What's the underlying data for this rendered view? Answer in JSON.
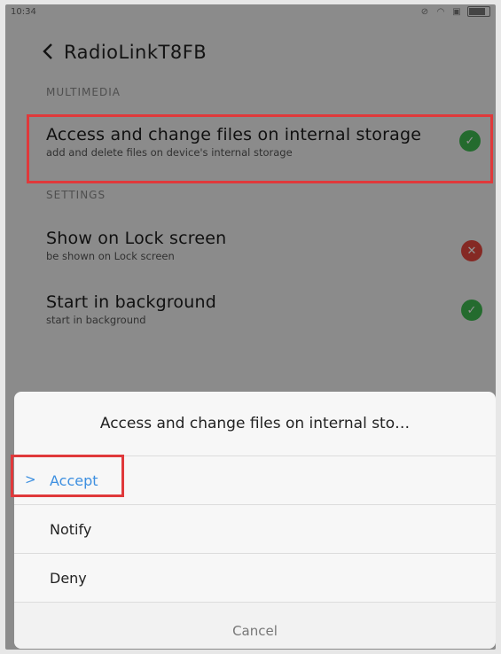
{
  "status_bar": {
    "time": "10:34"
  },
  "header": {
    "title": "RadioLinkT8FB"
  },
  "sections": {
    "multimedia": "MULTIMEDIA",
    "settings": "SETTINGS"
  },
  "permissions": [
    {
      "title": "Access and change files on internal storage",
      "subtitle": "add and delete files on device's internal storage",
      "status": "allowed"
    },
    {
      "title": "Show on Lock screen",
      "subtitle": "be shown on Lock screen",
      "status": "denied"
    },
    {
      "title": "Start in background",
      "subtitle": "start in background",
      "status": "allowed"
    }
  ],
  "dialog": {
    "title": "Access and change files on internal sto…",
    "options": [
      "Accept",
      "Notify",
      "Deny"
    ],
    "selected": "Accept",
    "cancel": "Cancel"
  },
  "colors": {
    "allowed": "#3fb950",
    "denied": "#e5483f",
    "accent": "#3d8fe0",
    "highlight": "#e0393b"
  }
}
